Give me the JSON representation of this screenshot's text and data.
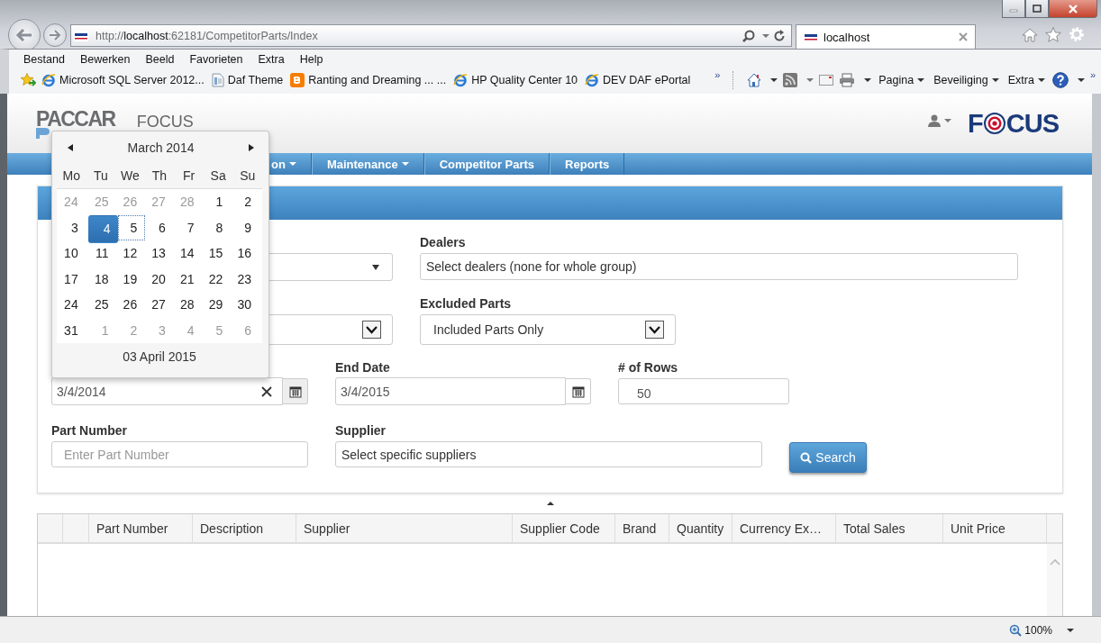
{
  "browser": {
    "address": "http://**localhost**:62181/CompetitorParts/Index",
    "tabs": [
      {
        "label": "localhost",
        "selected": true
      }
    ],
    "menu": [
      "Bestand",
      "Bewerken",
      "Beeld",
      "Favorieten",
      "Extra",
      "Help"
    ],
    "favorites": [
      {
        "kind": "ie",
        "label": "Microsoft SQL Server 2012..."
      },
      {
        "kind": "page",
        "label": "Daf Theme"
      },
      {
        "kind": "blogger",
        "label": "Ranting and Dreaming ... ..."
      },
      {
        "kind": "ie",
        "label": "HP Quality Center 10"
      },
      {
        "kind": "ie",
        "label": "DEV DAF ePortal"
      }
    ],
    "favorites_more": "»",
    "commands": [
      {
        "kind": "home"
      },
      {
        "kind": "feed"
      },
      {
        "kind": "mail"
      },
      {
        "kind": "print"
      },
      {
        "kind": "menu",
        "label": "Pagina"
      },
      {
        "kind": "menu",
        "label": "Beveiliging"
      },
      {
        "kind": "menu",
        "label": "Extra"
      },
      {
        "kind": "help"
      }
    ],
    "commands_more": "»",
    "zoom": "100%"
  },
  "app": {
    "logo_top": "PACCAR",
    "title": "FOCUS",
    "focus_logo": {
      "left": "F",
      "right": "CUS"
    },
    "nav": [
      {
        "label": "on",
        "dropdown": true
      },
      {
        "label": "Maintenance",
        "dropdown": true
      },
      {
        "label": "Competitor Parts",
        "dropdown": false
      },
      {
        "label": "Reports",
        "dropdown": false
      }
    ]
  },
  "form": {
    "dealers": {
      "label": "Dealers",
      "placeholder": "Select dealers (none for whole group)"
    },
    "excluded_parts": {
      "label": "Excluded Parts",
      "value": "Included Parts Only"
    },
    "start_date": {
      "value": "3/4/2014"
    },
    "end_date": {
      "label": "End Date",
      "value": "3/4/2015"
    },
    "rows": {
      "label": "# of Rows",
      "value": "50"
    },
    "part_number": {
      "label": "Part Number",
      "placeholder": "Enter Part Number"
    },
    "supplier": {
      "label": "Supplier",
      "placeholder": "Select specific suppliers"
    },
    "search_button": "Search"
  },
  "grid": {
    "columns": [
      "Part Number",
      "Description",
      "Supplier",
      "Supplier Code",
      "Brand",
      "Quantity",
      "Currency Ex…",
      "Total Sales",
      "Unit Price"
    ]
  },
  "calendar": {
    "title": "March 2014",
    "weekdays": [
      "Mo",
      "Tu",
      "We",
      "Th",
      "Fr",
      "Sa",
      "Su"
    ],
    "today": "03 April 2015",
    "days": [
      {
        "label": "24",
        "muted": true,
        "selected": false,
        "focused": false
      },
      {
        "label": "25",
        "muted": true,
        "selected": false,
        "focused": false
      },
      {
        "label": "26",
        "muted": true,
        "selected": false,
        "focused": false
      },
      {
        "label": "27",
        "muted": true,
        "selected": false,
        "focused": false
      },
      {
        "label": "28",
        "muted": true,
        "selected": false,
        "focused": false
      },
      {
        "label": "1",
        "muted": false,
        "selected": false,
        "focused": false
      },
      {
        "label": "2",
        "muted": false,
        "selected": false,
        "focused": false
      },
      {
        "label": "3",
        "muted": false,
        "selected": false,
        "focused": false
      },
      {
        "label": "4",
        "muted": false,
        "selected": true,
        "focused": false
      },
      {
        "label": "5",
        "muted": false,
        "selected": false,
        "focused": true
      },
      {
        "label": "6",
        "muted": false,
        "selected": false,
        "focused": false
      },
      {
        "label": "7",
        "muted": false,
        "selected": false,
        "focused": false
      },
      {
        "label": "8",
        "muted": false,
        "selected": false,
        "focused": false
      },
      {
        "label": "9",
        "muted": false,
        "selected": false,
        "focused": false
      },
      {
        "label": "10",
        "muted": false,
        "selected": false,
        "focused": false
      },
      {
        "label": "11",
        "muted": false,
        "selected": false,
        "focused": false
      },
      {
        "label": "12",
        "muted": false,
        "selected": false,
        "focused": false
      },
      {
        "label": "13",
        "muted": false,
        "selected": false,
        "focused": false
      },
      {
        "label": "14",
        "muted": false,
        "selected": false,
        "focused": false
      },
      {
        "label": "15",
        "muted": false,
        "selected": false,
        "focused": false
      },
      {
        "label": "16",
        "muted": false,
        "selected": false,
        "focused": false
      },
      {
        "label": "17",
        "muted": false,
        "selected": false,
        "focused": false
      },
      {
        "label": "18",
        "muted": false,
        "selected": false,
        "focused": false
      },
      {
        "label": "19",
        "muted": false,
        "selected": false,
        "focused": false
      },
      {
        "label": "20",
        "muted": false,
        "selected": false,
        "focused": false
      },
      {
        "label": "21",
        "muted": false,
        "selected": false,
        "focused": false
      },
      {
        "label": "22",
        "muted": false,
        "selected": false,
        "focused": false
      },
      {
        "label": "23",
        "muted": false,
        "selected": false,
        "focused": false
      },
      {
        "label": "24",
        "muted": false,
        "selected": false,
        "focused": false
      },
      {
        "label": "25",
        "muted": false,
        "selected": false,
        "focused": false
      },
      {
        "label": "26",
        "muted": false,
        "selected": false,
        "focused": false
      },
      {
        "label": "27",
        "muted": false,
        "selected": false,
        "focused": false
      },
      {
        "label": "28",
        "muted": false,
        "selected": false,
        "focused": false
      },
      {
        "label": "29",
        "muted": false,
        "selected": false,
        "focused": false
      },
      {
        "label": "30",
        "muted": false,
        "selected": false,
        "focused": false
      },
      {
        "label": "31",
        "muted": false,
        "selected": false,
        "focused": false
      },
      {
        "label": "1",
        "muted": true,
        "selected": false,
        "focused": false
      },
      {
        "label": "2",
        "muted": true,
        "selected": false,
        "focused": false
      },
      {
        "label": "3",
        "muted": true,
        "selected": false,
        "focused": false
      },
      {
        "label": "4",
        "muted": true,
        "selected": false,
        "focused": false
      },
      {
        "label": "5",
        "muted": true,
        "selected": false,
        "focused": false
      },
      {
        "label": "6",
        "muted": true,
        "selected": false,
        "focused": false
      }
    ]
  }
}
